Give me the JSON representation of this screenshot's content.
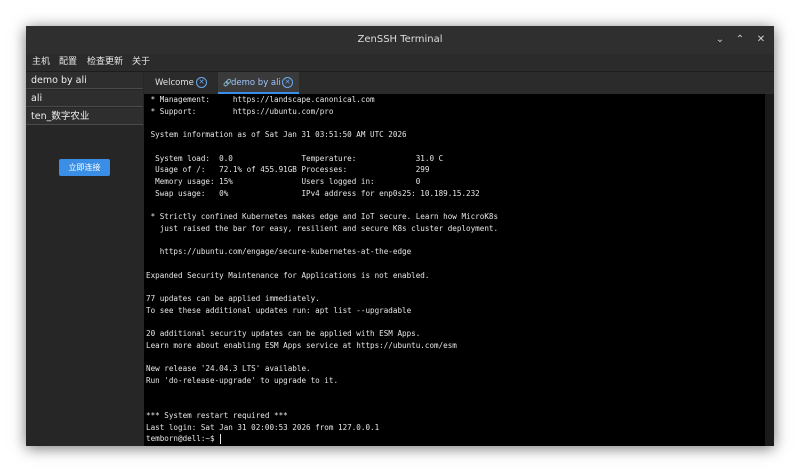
{
  "window": {
    "title": "ZenSSH Terminal",
    "buttons": {
      "minimize": "⌄",
      "maximize": "⌃",
      "close": "✕"
    }
  },
  "menu": [
    "主机",
    "配置",
    "检查更新",
    "关于"
  ],
  "sidebar": {
    "items": [
      "demo by ali",
      "ali",
      "ten_数字农业"
    ],
    "connect_label": "立即连接"
  },
  "tabs": [
    {
      "label": "Welcome",
      "active": false
    },
    {
      "label": "demo by ali",
      "prefix_icon": "🔗",
      "active": true
    }
  ],
  "terminal": {
    "lines": [
      " * Management:     https://landscape.canonical.com",
      " * Support:        https://ubuntu.com/pro",
      "",
      " System information as of Sat Jan 31 03:51:50 AM UTC 2026",
      "",
      "  System load:  0.0               Temperature:             31.0 C",
      "  Usage of /:   72.1% of 455.91GB Processes:               299",
      "  Memory usage: 15%               Users logged in:         0",
      "  Swap usage:   0%                IPv4 address for enp0s25: 10.189.15.232",
      "",
      " * Strictly confined Kubernetes makes edge and IoT secure. Learn how MicroK8s",
      "   just raised the bar for easy, resilient and secure K8s cluster deployment.",
      "",
      "   https://ubuntu.com/engage/secure-kubernetes-at-the-edge",
      "",
      "Expanded Security Maintenance for Applications is not enabled.",
      "",
      "77 updates can be applied immediately.",
      "To see these additional updates run: apt list --upgradable",
      "",
      "20 additional security updates can be applied with ESM Apps.",
      "Learn more about enabling ESM Apps service at https://ubuntu.com/esm",
      "",
      "New release '24.04.3 LTS' available.",
      "Run 'do-release-upgrade' to upgrade to it.",
      "",
      "",
      "*** System restart required ***",
      "Last login: Sat Jan 31 02:00:53 2026 from 127.0.0.1",
      "temborn@dell:~$ "
    ]
  }
}
